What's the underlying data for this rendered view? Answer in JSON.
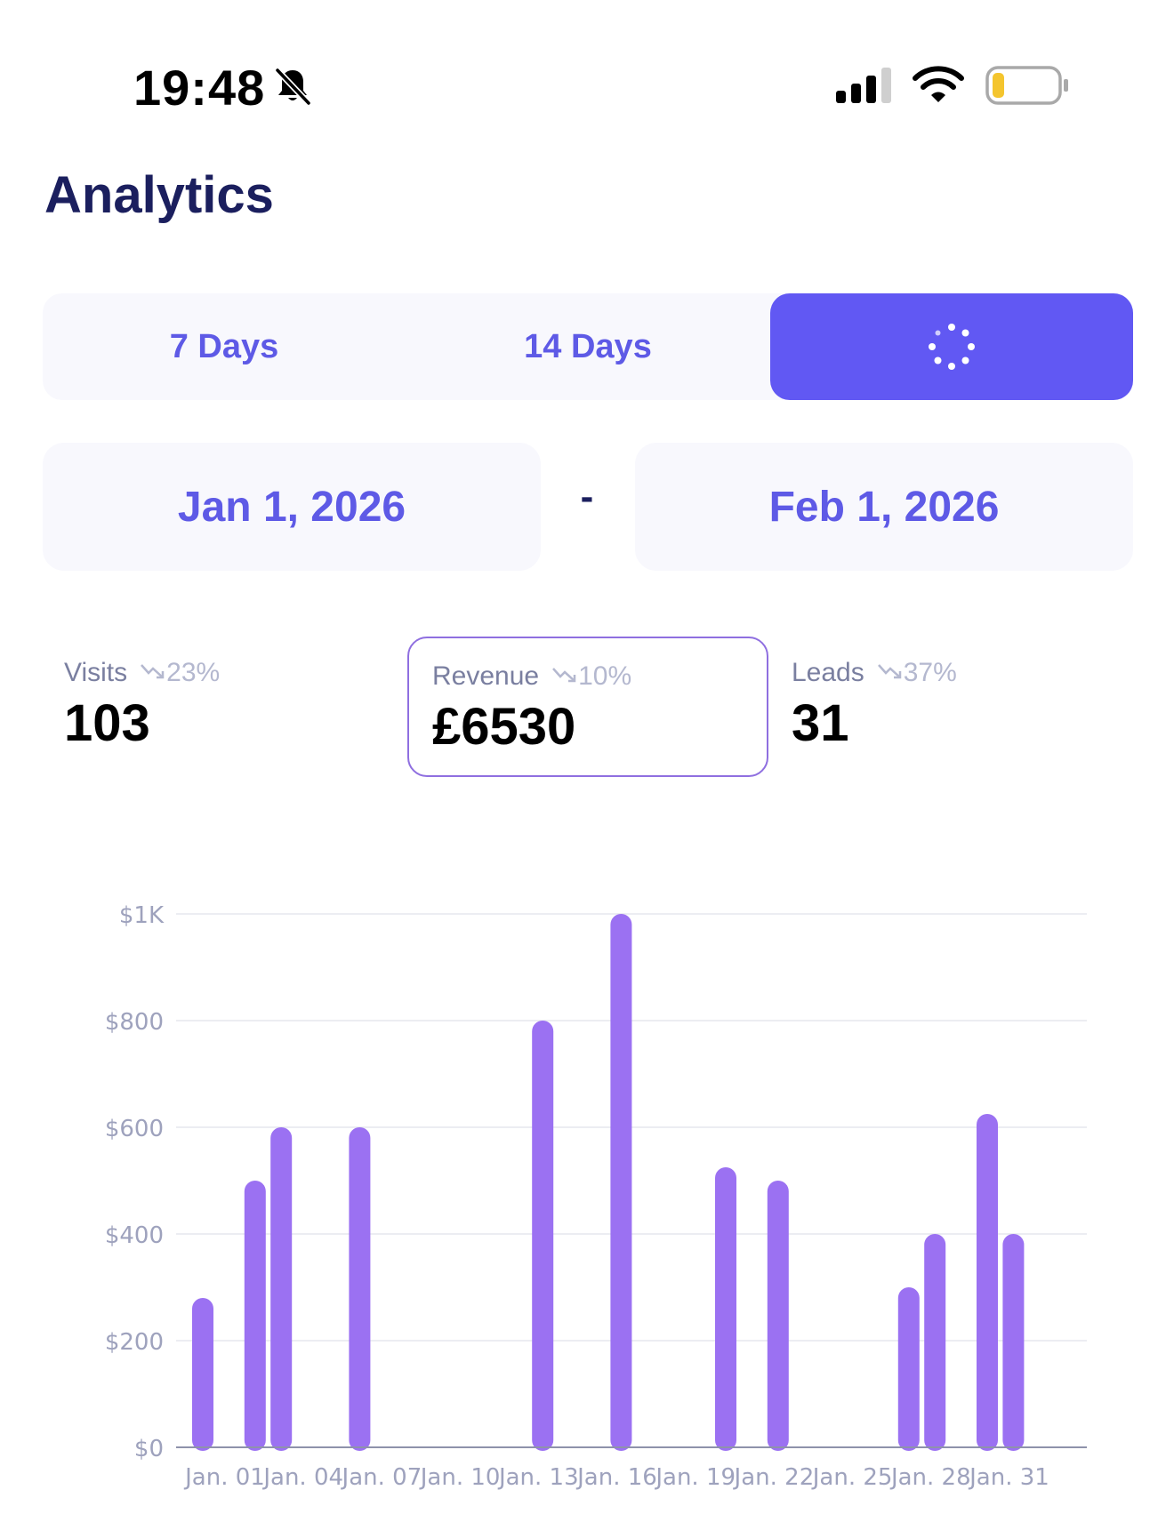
{
  "status_bar": {
    "time": "19:48",
    "icons": [
      "bell-slash-icon",
      "cellular-signal-icon",
      "wifi-icon",
      "battery-low-icon"
    ]
  },
  "page": {
    "title": "Analytics"
  },
  "range_tabs": {
    "items": [
      {
        "label": "7 Days"
      },
      {
        "label": "14 Days"
      }
    ],
    "active_state": "loading-spinner-icon",
    "active_color": "#6158f3"
  },
  "date_range": {
    "start": "Jan 1, 2026",
    "separator": "-",
    "end": "Feb 1, 2026"
  },
  "metrics": {
    "visits": {
      "label": "Visits",
      "change": "23%",
      "trend_icon": "trend-down-icon",
      "value": "103"
    },
    "revenue": {
      "label": "Revenue",
      "change": "10%",
      "trend_icon": "trend-down-icon",
      "value": "£6530",
      "selected": true
    },
    "leads": {
      "label": "Leads",
      "change": "37%",
      "trend_icon": "trend-down-icon",
      "value": "31"
    }
  },
  "colors": {
    "accent": "#6158f3",
    "bar": "#9b71f2",
    "title": "#1b1f5e"
  },
  "chart_data": {
    "type": "bar",
    "x": [
      "Jan. 01",
      "Jan. 02",
      "Jan. 03",
      "Jan. 04",
      "Jan. 05",
      "Jan. 06",
      "Jan. 07",
      "Jan. 08",
      "Jan. 09",
      "Jan. 10",
      "Jan. 11",
      "Jan. 12",
      "Jan. 13",
      "Jan. 14",
      "Jan. 15",
      "Jan. 16",
      "Jan. 17",
      "Jan. 18",
      "Jan. 19",
      "Jan. 20",
      "Jan. 21",
      "Jan. 22",
      "Jan. 23",
      "Jan. 24",
      "Jan. 25",
      "Jan. 26",
      "Jan. 27",
      "Jan. 28",
      "Jan. 29",
      "Jan. 30",
      "Jan. 31",
      "Feb. 01"
    ],
    "values": [
      280,
      0,
      500,
      600,
      0,
      0,
      600,
      0,
      0,
      0,
      0,
      0,
      0,
      800,
      0,
      0,
      1000,
      0,
      0,
      0,
      525,
      0,
      500,
      0,
      0,
      0,
      0,
      300,
      400,
      0,
      625,
      400
    ],
    "tick_labels": [
      "Jan. 01",
      "Jan. 04",
      "Jan. 07",
      "Jan. 10",
      "Jan. 13",
      "Jan. 16",
      "Jan. 19",
      "Jan. 22",
      "Jan. 25",
      "Jan. 28",
      "Jan. 31"
    ],
    "y_ticks": [
      {
        "value": 0,
        "label": "$0"
      },
      {
        "value": 200,
        "label": "$200"
      },
      {
        "value": 400,
        "label": "$400"
      },
      {
        "value": 600,
        "label": "$600"
      },
      {
        "value": 800,
        "label": "$800"
      },
      {
        "value": 1000,
        "label": "$1K"
      }
    ],
    "ylim": [
      0,
      1000
    ],
    "grid": true
  }
}
